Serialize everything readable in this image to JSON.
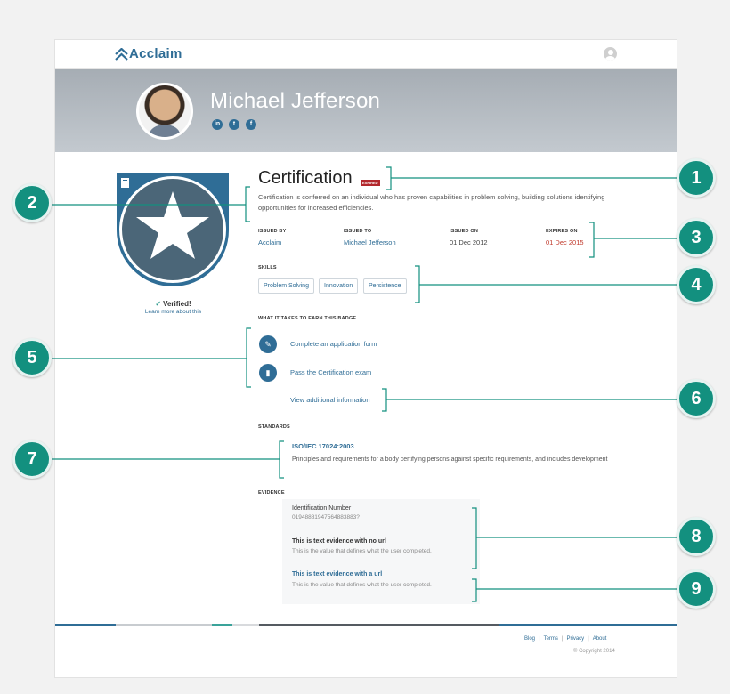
{
  "header": {
    "logo": "Acclaim"
  },
  "profile": {
    "name": "Michael Jefferson",
    "social": [
      "in",
      "t",
      "f"
    ]
  },
  "badge": {
    "verified_label": "Verified!",
    "learn_more": "Learn more about this"
  },
  "certification": {
    "title": "Certification",
    "status_badge": "EXPIRED",
    "description": "Certification is conferred on an individual who has proven capabilities in problem solving, building solutions identifying opportunities for increased efficiencies."
  },
  "meta": {
    "issued_by_label": "ISSUED BY",
    "issued_by": "Acclaim",
    "issued_to_label": "ISSUED TO",
    "issued_to": "Michael Jefferson",
    "issued_on_label": "ISSUED ON",
    "issued_on": "01 Dec 2012",
    "expires_on_label": "EXPIRES ON",
    "expires_on": "01 Dec 2015"
  },
  "skills": {
    "label": "SKILLS",
    "items": [
      "Problem Solving",
      "Innovation",
      "Persistence"
    ]
  },
  "earn": {
    "label": "WHAT IT TAKES TO EARN THIS BADGE",
    "steps": [
      "Complete an application form",
      "Pass the Certification exam"
    ],
    "additional": "View additional information"
  },
  "standards": {
    "label": "STANDARDS",
    "title": "ISO/IEC 17024:2003",
    "description": "Principles and requirements for a body certifying persons against specific requirements, and includes development"
  },
  "evidence": {
    "label": "EVIDENCE",
    "items": [
      {
        "title": "Identification Number",
        "value": "01948881947564883883?"
      },
      {
        "title": "This is text evidence with no url",
        "value": "This is the value that defines what the user completed."
      },
      {
        "title": "This is text evidence with a url",
        "value": "This is the value that defines what the user completed."
      }
    ]
  },
  "footer": {
    "links": [
      "Blog",
      "Terms",
      "Privacy",
      "About"
    ],
    "separator": "|",
    "copyright": "© Copyright 2014"
  },
  "callouts": [
    "1",
    "2",
    "3",
    "4",
    "5",
    "6",
    "7",
    "8",
    "9"
  ],
  "colors": {
    "accent": "#2f6d96",
    "callout": "#13907f",
    "expired": "#b3282d"
  }
}
